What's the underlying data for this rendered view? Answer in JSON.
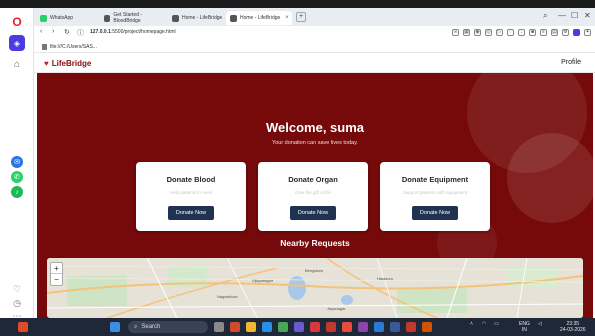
{
  "browser": {
    "tabs": [
      {
        "label": "WhatsApp",
        "color": "#25d366"
      },
      {
        "label": "Get Started - BloodBridge",
        "color": "#555555"
      },
      {
        "label": "Home - LifeBridge",
        "color": "#555555"
      },
      {
        "label": "Home - LifeBridge",
        "color": "#555555",
        "active": true
      }
    ],
    "url_host": "127.0.0.1",
    "url_rest": ":5500/project/homepage.html",
    "bookmark": "file:///C:/Users/SAS..."
  },
  "page": {
    "brand": "LifeBridge",
    "profile_link": "Profile",
    "welcome": "Welcome, suma",
    "tagline": "Your donation can save lives today.",
    "cards": [
      {
        "title": "Donate Blood",
        "subtitle": "Help patients in need",
        "button": "Donate Now"
      },
      {
        "title": "Donate Organ",
        "subtitle": "Give the gift of life",
        "button": "Donate Now"
      },
      {
        "title": "Donate Equipment",
        "subtitle": "Support patients with equipment",
        "button": "Donate Now"
      }
    ],
    "nearby_title": "Nearby Requests",
    "map": {
      "zoom_in": "+",
      "zoom_out": "−",
      "labels": [
        "Bengaluru",
        "Nagarbhavi",
        "Vijayanagar",
        "Halasuru",
        "Jayanagar"
      ]
    }
  },
  "taskbar": {
    "search_placeholder": "Search",
    "lang_top": "ENG",
    "lang_bottom": "IN",
    "time": "23:35",
    "date": "24-03-2026"
  },
  "colors": {
    "hero_bg": "#760a0a",
    "brand": "#8a0b0b",
    "button_bg": "#1f3252"
  }
}
